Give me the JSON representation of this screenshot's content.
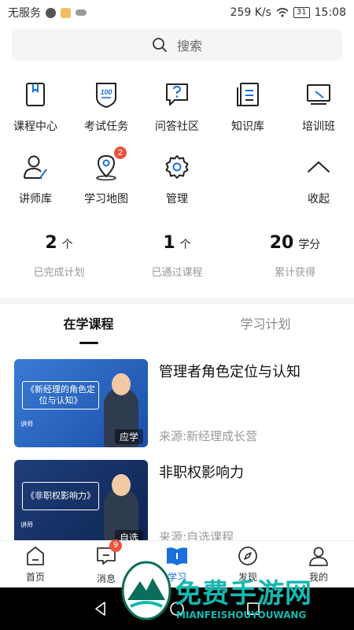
{
  "status_bar": {
    "carrier": "无服务",
    "speed": "259 K/s",
    "battery": "31",
    "time": "15:08"
  },
  "search": {
    "label": "搜索"
  },
  "grid": {
    "row1": [
      {
        "label": "课程中心",
        "icon": "book-icon"
      },
      {
        "label": "考试任务",
        "icon": "exam-100-icon"
      },
      {
        "label": "问答社区",
        "icon": "qa-icon"
      },
      {
        "label": "知识库",
        "icon": "knowledge-icon"
      },
      {
        "label": "培训班",
        "icon": "training-icon"
      }
    ],
    "row2": [
      {
        "label": "讲师库",
        "icon": "teacher-icon"
      },
      {
        "label": "学习地图",
        "icon": "map-icon",
        "badge": "2"
      },
      {
        "label": "管理",
        "icon": "gear-icon"
      },
      {
        "label": "",
        "icon": "blank"
      },
      {
        "label": "收起",
        "icon": "chevron-up-icon"
      }
    ]
  },
  "stats": [
    {
      "num": "2",
      "unit": "个",
      "label": "已完成计划"
    },
    {
      "num": "1",
      "unit": "个",
      "label": "已通过课程"
    },
    {
      "num": "20",
      "unit": "学分",
      "label": "累计获得"
    }
  ],
  "tabs": {
    "active": "在学课程",
    "other": "学习计划"
  },
  "courses": [
    {
      "title": "管理者角色定位与认知",
      "source": "来源:新经理成长营",
      "thumb_title": "《新经理的角色定位与认知》",
      "thumb_tag": "应学",
      "thumb_lecturer": "讲师"
    },
    {
      "title": "非职权影响力",
      "source": "来源:自选课程",
      "thumb_title": "《非职权影响力》",
      "thumb_tag": "自选",
      "thumb_lecturer": "讲师"
    }
  ],
  "bottom_nav": [
    {
      "label": "首页",
      "icon": "home-icon"
    },
    {
      "label": "消息",
      "icon": "message-icon",
      "badge": "9"
    },
    {
      "label": "学习",
      "icon": "study-book-icon",
      "active": true
    },
    {
      "label": "发现",
      "icon": "compass-icon"
    },
    {
      "label": "我的",
      "icon": "user-icon"
    }
  ],
  "watermark": {
    "text": "免费手游网",
    "sub": "MIANFEISHOUYOUWANG"
  },
  "colors": {
    "accent": "#1a6fd8",
    "badge": "#e8553f",
    "watermark": "#15b8b0"
  }
}
